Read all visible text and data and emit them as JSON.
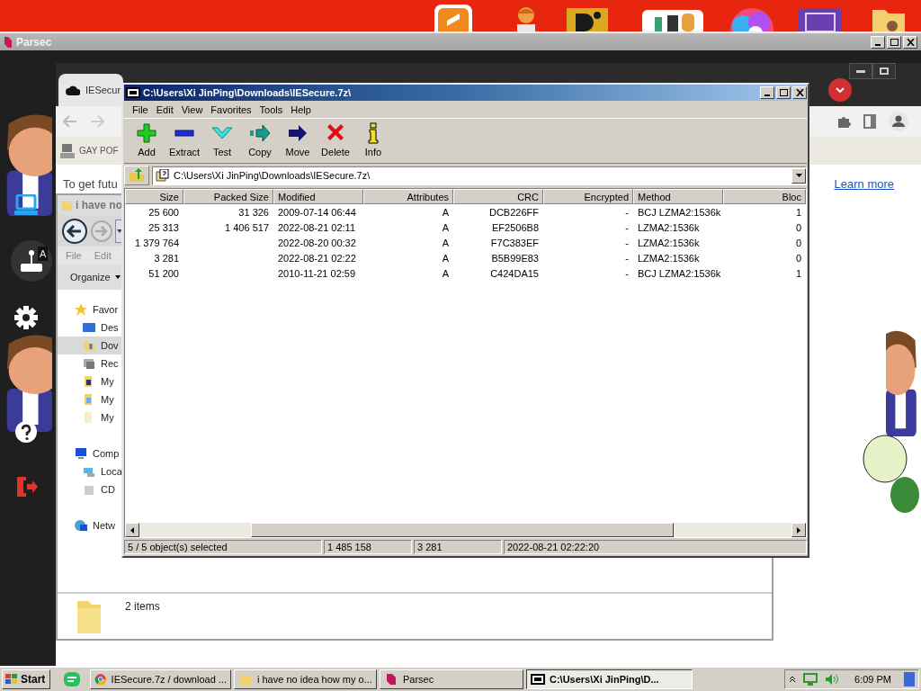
{
  "parsec": {
    "title": "Parsec",
    "sidebar_tooltip": "A"
  },
  "browser": {
    "tab": "IESecur",
    "bookmark": "GAY POF",
    "notice": "To get futu",
    "link": "Learn more"
  },
  "explorer": {
    "title": "i have no",
    "menu": [
      "File",
      "Edit"
    ],
    "organize": "Organize",
    "tree": [
      {
        "label": "Favor",
        "kind": "star",
        "selected": false,
        "children": [
          {
            "label": "Des",
            "kind": "desktop",
            "selected": false
          },
          {
            "label": "Dov",
            "kind": "downloads",
            "selected": true
          },
          {
            "label": "Rec",
            "kind": "recent",
            "selected": false
          },
          {
            "label": "My",
            "kind": "music",
            "selected": false
          },
          {
            "label": "My",
            "kind": "pictures",
            "selected": false
          },
          {
            "label": "My",
            "kind": "video",
            "selected": false
          }
        ]
      },
      {
        "label": "Comp",
        "kind": "computer",
        "selected": false,
        "children": [
          {
            "label": "Loca",
            "kind": "disk",
            "selected": false
          },
          {
            "label": "CD",
            "kind": "cd",
            "selected": false
          }
        ]
      },
      {
        "label": "Netw",
        "kind": "network",
        "selected": false
      }
    ],
    "status": "2 items"
  },
  "sevenzip": {
    "title": "C:\\Users\\Xi JinPing\\Downloads\\IESecure.7z\\",
    "menu": [
      "File",
      "Edit",
      "View",
      "Favorites",
      "Tools",
      "Help"
    ],
    "toolbar": [
      {
        "label": "Add",
        "kind": "add"
      },
      {
        "label": "Extract",
        "kind": "extract"
      },
      {
        "label": "Test",
        "kind": "test"
      },
      {
        "label": "Copy",
        "kind": "copy"
      },
      {
        "label": "Move",
        "kind": "move"
      },
      {
        "label": "Delete",
        "kind": "delete"
      },
      {
        "label": "Info",
        "kind": "info"
      }
    ],
    "path": "C:\\Users\\Xi JinPing\\Downloads\\IESecure.7z\\",
    "columns": [
      "Size",
      "Packed Size",
      "Modified",
      "Attributes",
      "CRC",
      "Encrypted",
      "Method",
      "Bloc"
    ],
    "rows": [
      [
        "25 600",
        "31 326",
        "2009-07-14 06:44",
        "A",
        "DCB226FF",
        "-",
        "BCJ LZMA2:1536k",
        "1"
      ],
      [
        "25 313",
        "1 406 517",
        "2022-08-21 02:11",
        "A",
        "EF2506B8",
        "-",
        "LZMA2:1536k",
        "0"
      ],
      [
        "1 379 764",
        "",
        "2022-08-20 00:32",
        "A",
        "F7C383EF",
        "-",
        "LZMA2:1536k",
        "0"
      ],
      [
        "3 281",
        "",
        "2022-08-21 02:22",
        "A",
        "B5B99E83",
        "-",
        "LZMA2:1536k",
        "0"
      ],
      [
        "51 200",
        "",
        "2010-11-21 02:59",
        "A",
        "C424DA15",
        "-",
        "BCJ LZMA2:1536k",
        "1"
      ]
    ],
    "status": [
      "5 / 5 object(s) selected",
      "1 485 158",
      "3 281",
      "2022-08-21 02:22:20"
    ]
  },
  "taskbar": {
    "start": "Start",
    "tasks": [
      {
        "label": "IESecure.7z / download ...",
        "kind": "chrome",
        "selected": false
      },
      {
        "label": "i have no idea how my o...",
        "kind": "folder",
        "selected": false
      },
      {
        "label": "Parsec",
        "kind": "parsec",
        "selected": false
      },
      {
        "label": "C:\\Users\\Xi JinPing\\D...",
        "kind": "sevenzip",
        "selected": true
      }
    ],
    "clock": "6:09 PM"
  }
}
